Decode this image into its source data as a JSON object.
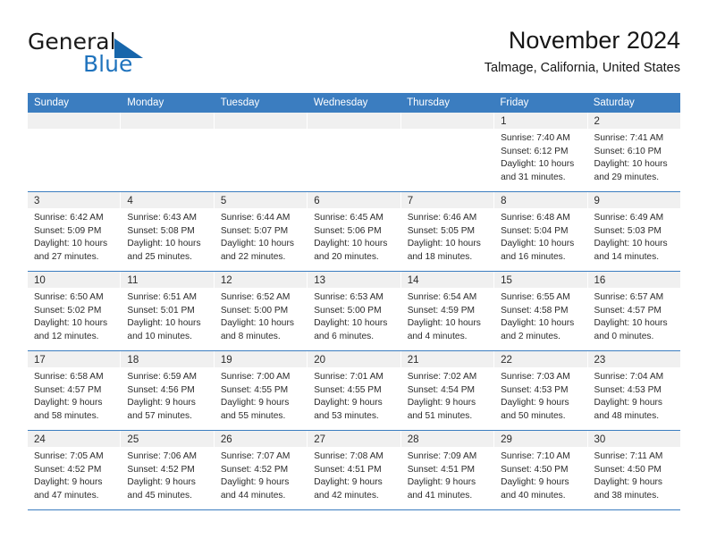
{
  "brand": {
    "word1": "General",
    "word2": "Blue",
    "logo_icon": "blue-triangle-icon",
    "accent_color": "#1f73bd"
  },
  "header": {
    "month_title": "November 2024",
    "location": "Talmage, California, United States"
  },
  "calendar": {
    "header_bg": "#3b7dc0",
    "weekdays": [
      "Sunday",
      "Monday",
      "Tuesday",
      "Wednesday",
      "Thursday",
      "Friday",
      "Saturday"
    ],
    "weeks": [
      [
        {
          "day": "",
          "empty": true,
          "sunrise": "",
          "sunset": "",
          "daylight1": "",
          "daylight2": ""
        },
        {
          "day": "",
          "empty": true,
          "sunrise": "",
          "sunset": "",
          "daylight1": "",
          "daylight2": ""
        },
        {
          "day": "",
          "empty": true,
          "sunrise": "",
          "sunset": "",
          "daylight1": "",
          "daylight2": ""
        },
        {
          "day": "",
          "empty": true,
          "sunrise": "",
          "sunset": "",
          "daylight1": "",
          "daylight2": ""
        },
        {
          "day": "",
          "empty": true,
          "sunrise": "",
          "sunset": "",
          "daylight1": "",
          "daylight2": ""
        },
        {
          "day": "1",
          "empty": false,
          "sunrise": "Sunrise: 7:40 AM",
          "sunset": "Sunset: 6:12 PM",
          "daylight1": "Daylight: 10 hours",
          "daylight2": "and 31 minutes."
        },
        {
          "day": "2",
          "empty": false,
          "sunrise": "Sunrise: 7:41 AM",
          "sunset": "Sunset: 6:10 PM",
          "daylight1": "Daylight: 10 hours",
          "daylight2": "and 29 minutes."
        }
      ],
      [
        {
          "day": "3",
          "empty": false,
          "sunrise": "Sunrise: 6:42 AM",
          "sunset": "Sunset: 5:09 PM",
          "daylight1": "Daylight: 10 hours",
          "daylight2": "and 27 minutes."
        },
        {
          "day": "4",
          "empty": false,
          "sunrise": "Sunrise: 6:43 AM",
          "sunset": "Sunset: 5:08 PM",
          "daylight1": "Daylight: 10 hours",
          "daylight2": "and 25 minutes."
        },
        {
          "day": "5",
          "empty": false,
          "sunrise": "Sunrise: 6:44 AM",
          "sunset": "Sunset: 5:07 PM",
          "daylight1": "Daylight: 10 hours",
          "daylight2": "and 22 minutes."
        },
        {
          "day": "6",
          "empty": false,
          "sunrise": "Sunrise: 6:45 AM",
          "sunset": "Sunset: 5:06 PM",
          "daylight1": "Daylight: 10 hours",
          "daylight2": "and 20 minutes."
        },
        {
          "day": "7",
          "empty": false,
          "sunrise": "Sunrise: 6:46 AM",
          "sunset": "Sunset: 5:05 PM",
          "daylight1": "Daylight: 10 hours",
          "daylight2": "and 18 minutes."
        },
        {
          "day": "8",
          "empty": false,
          "sunrise": "Sunrise: 6:48 AM",
          "sunset": "Sunset: 5:04 PM",
          "daylight1": "Daylight: 10 hours",
          "daylight2": "and 16 minutes."
        },
        {
          "day": "9",
          "empty": false,
          "sunrise": "Sunrise: 6:49 AM",
          "sunset": "Sunset: 5:03 PM",
          "daylight1": "Daylight: 10 hours",
          "daylight2": "and 14 minutes."
        }
      ],
      [
        {
          "day": "10",
          "empty": false,
          "sunrise": "Sunrise: 6:50 AM",
          "sunset": "Sunset: 5:02 PM",
          "daylight1": "Daylight: 10 hours",
          "daylight2": "and 12 minutes."
        },
        {
          "day": "11",
          "empty": false,
          "sunrise": "Sunrise: 6:51 AM",
          "sunset": "Sunset: 5:01 PM",
          "daylight1": "Daylight: 10 hours",
          "daylight2": "and 10 minutes."
        },
        {
          "day": "12",
          "empty": false,
          "sunrise": "Sunrise: 6:52 AM",
          "sunset": "Sunset: 5:00 PM",
          "daylight1": "Daylight: 10 hours",
          "daylight2": "and 8 minutes."
        },
        {
          "day": "13",
          "empty": false,
          "sunrise": "Sunrise: 6:53 AM",
          "sunset": "Sunset: 5:00 PM",
          "daylight1": "Daylight: 10 hours",
          "daylight2": "and 6 minutes."
        },
        {
          "day": "14",
          "empty": false,
          "sunrise": "Sunrise: 6:54 AM",
          "sunset": "Sunset: 4:59 PM",
          "daylight1": "Daylight: 10 hours",
          "daylight2": "and 4 minutes."
        },
        {
          "day": "15",
          "empty": false,
          "sunrise": "Sunrise: 6:55 AM",
          "sunset": "Sunset: 4:58 PM",
          "daylight1": "Daylight: 10 hours",
          "daylight2": "and 2 minutes."
        },
        {
          "day": "16",
          "empty": false,
          "sunrise": "Sunrise: 6:57 AM",
          "sunset": "Sunset: 4:57 PM",
          "daylight1": "Daylight: 10 hours",
          "daylight2": "and 0 minutes."
        }
      ],
      [
        {
          "day": "17",
          "empty": false,
          "sunrise": "Sunrise: 6:58 AM",
          "sunset": "Sunset: 4:57 PM",
          "daylight1": "Daylight: 9 hours",
          "daylight2": "and 58 minutes."
        },
        {
          "day": "18",
          "empty": false,
          "sunrise": "Sunrise: 6:59 AM",
          "sunset": "Sunset: 4:56 PM",
          "daylight1": "Daylight: 9 hours",
          "daylight2": "and 57 minutes."
        },
        {
          "day": "19",
          "empty": false,
          "sunrise": "Sunrise: 7:00 AM",
          "sunset": "Sunset: 4:55 PM",
          "daylight1": "Daylight: 9 hours",
          "daylight2": "and 55 minutes."
        },
        {
          "day": "20",
          "empty": false,
          "sunrise": "Sunrise: 7:01 AM",
          "sunset": "Sunset: 4:55 PM",
          "daylight1": "Daylight: 9 hours",
          "daylight2": "and 53 minutes."
        },
        {
          "day": "21",
          "empty": false,
          "sunrise": "Sunrise: 7:02 AM",
          "sunset": "Sunset: 4:54 PM",
          "daylight1": "Daylight: 9 hours",
          "daylight2": "and 51 minutes."
        },
        {
          "day": "22",
          "empty": false,
          "sunrise": "Sunrise: 7:03 AM",
          "sunset": "Sunset: 4:53 PM",
          "daylight1": "Daylight: 9 hours",
          "daylight2": "and 50 minutes."
        },
        {
          "day": "23",
          "empty": false,
          "sunrise": "Sunrise: 7:04 AM",
          "sunset": "Sunset: 4:53 PM",
          "daylight1": "Daylight: 9 hours",
          "daylight2": "and 48 minutes."
        }
      ],
      [
        {
          "day": "24",
          "empty": false,
          "sunrise": "Sunrise: 7:05 AM",
          "sunset": "Sunset: 4:52 PM",
          "daylight1": "Daylight: 9 hours",
          "daylight2": "and 47 minutes."
        },
        {
          "day": "25",
          "empty": false,
          "sunrise": "Sunrise: 7:06 AM",
          "sunset": "Sunset: 4:52 PM",
          "daylight1": "Daylight: 9 hours",
          "daylight2": "and 45 minutes."
        },
        {
          "day": "26",
          "empty": false,
          "sunrise": "Sunrise: 7:07 AM",
          "sunset": "Sunset: 4:52 PM",
          "daylight1": "Daylight: 9 hours",
          "daylight2": "and 44 minutes."
        },
        {
          "day": "27",
          "empty": false,
          "sunrise": "Sunrise: 7:08 AM",
          "sunset": "Sunset: 4:51 PM",
          "daylight1": "Daylight: 9 hours",
          "daylight2": "and 42 minutes."
        },
        {
          "day": "28",
          "empty": false,
          "sunrise": "Sunrise: 7:09 AM",
          "sunset": "Sunset: 4:51 PM",
          "daylight1": "Daylight: 9 hours",
          "daylight2": "and 41 minutes."
        },
        {
          "day": "29",
          "empty": false,
          "sunrise": "Sunrise: 7:10 AM",
          "sunset": "Sunset: 4:50 PM",
          "daylight1": "Daylight: 9 hours",
          "daylight2": "and 40 minutes."
        },
        {
          "day": "30",
          "empty": false,
          "sunrise": "Sunrise: 7:11 AM",
          "sunset": "Sunset: 4:50 PM",
          "daylight1": "Daylight: 9 hours",
          "daylight2": "and 38 minutes."
        }
      ]
    ]
  }
}
